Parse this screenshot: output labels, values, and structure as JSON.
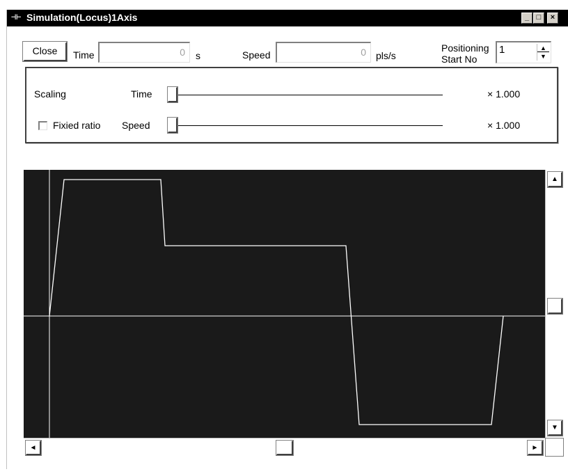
{
  "window": {
    "icon": "ladder-icon",
    "title": "Simulation(Locus)1Axis",
    "controls": {
      "minimize": "_",
      "maximize": "□",
      "close": "×"
    }
  },
  "toolbar": {
    "close_label": "Close",
    "time_label": "Time",
    "time_value": "0",
    "time_unit": "s",
    "speed_label": "Speed",
    "speed_value": "0",
    "speed_unit": "pls/s",
    "positioning_label_line1": "Positioning",
    "positioning_label_line2": "Start No",
    "positioning_value": "1"
  },
  "scaling": {
    "title": "Scaling",
    "time_label": "Time",
    "time_factor": "× 1.000",
    "time_level": 0,
    "fixed_ratio_label": "Fixied ratio",
    "fixed_ratio_checked": false,
    "speed_label": "Speed",
    "speed_factor": "× 1.000",
    "speed_level": 0
  },
  "plot": {
    "background": "#1a1a1a",
    "line_color": "#ffffff"
  },
  "scrollbars": {
    "up_arrow": "▲",
    "down_arrow": "▼",
    "left_arrow": "◄",
    "right_arrow": "►"
  }
}
